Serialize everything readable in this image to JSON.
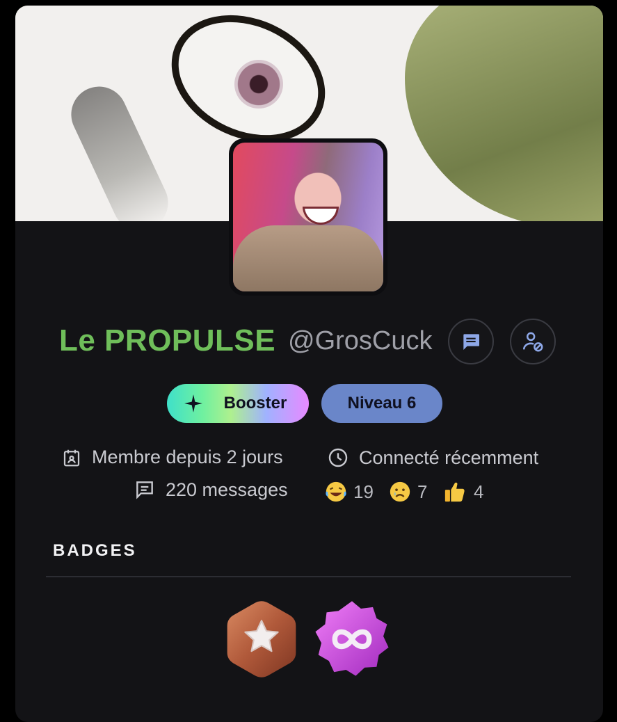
{
  "profile": {
    "display_name": "Le PROPULSE",
    "handle": "@GrosCuck",
    "name_color": "#6fbe5a"
  },
  "actions": {
    "message_icon": "message-icon",
    "manage_icon": "user-block-icon"
  },
  "tags": {
    "booster": "Booster",
    "level": "Niveau 6"
  },
  "stats": {
    "member_since": "Membre depuis 2 jours",
    "last_seen": "Connecté récemment",
    "messages": "220 messages"
  },
  "reactions": [
    {
      "icon": "laughing-emoji",
      "count": "19"
    },
    {
      "icon": "crying-emoji",
      "count": "7"
    },
    {
      "icon": "thumbs-up-emoji",
      "count": "4"
    }
  ],
  "badges": {
    "title": "BADGES",
    "items": [
      {
        "icon": "star-hexagon-badge",
        "color": "#b5603f"
      },
      {
        "icon": "infinity-badge",
        "color": "#c93bd6"
      }
    ]
  },
  "colors": {
    "background": "#131316",
    "level_pill": "#6a86c9",
    "action_icon": "#8ea8e8"
  }
}
